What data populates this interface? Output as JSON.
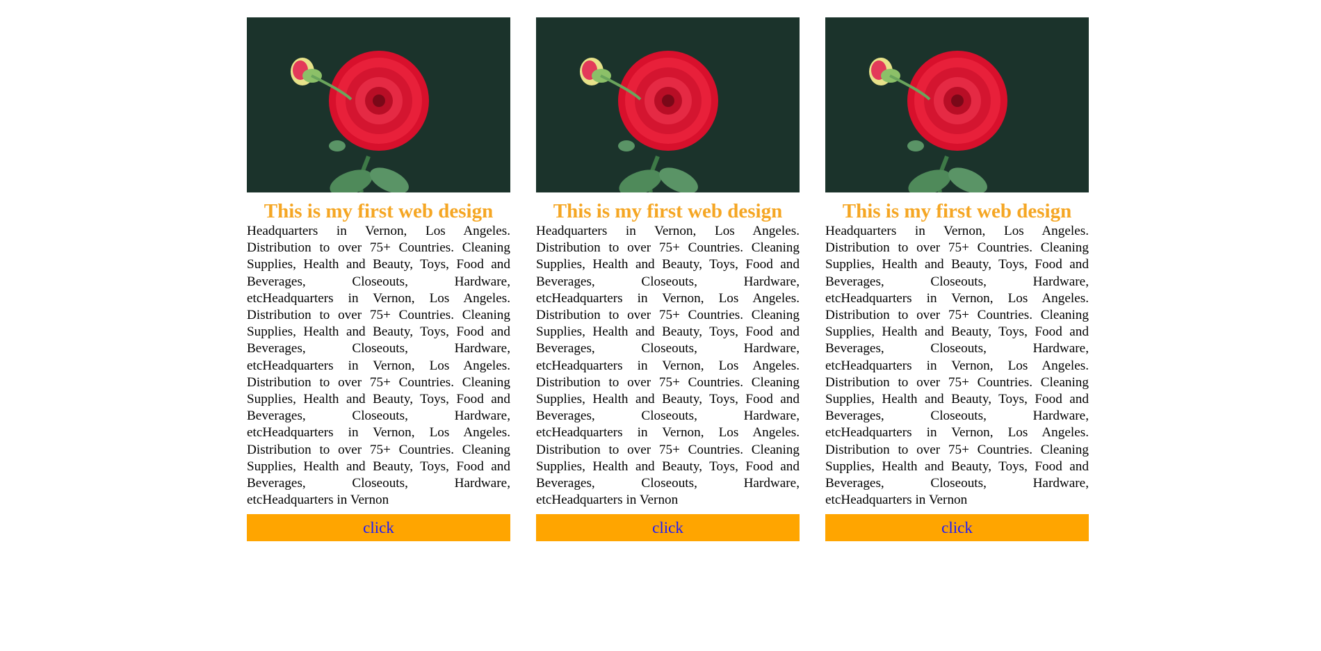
{
  "cards": [
    {
      "image_alt": "flower-image",
      "title": "This is my first web design",
      "text": "Headquarters in Vernon, Los Angeles. Distribution to over 75+ Countries. Cleaning Supplies, Health and Beauty, Toys, Food and Beverages, Closeouts, Hardware, etcHeadquarters in Vernon, Los Angeles. Distribution to over 75+ Countries. Cleaning Supplies, Health and Beauty, Toys, Food and Beverages, Closeouts, Hardware, etcHeadquarters in Vernon, Los Angeles. Distribution to over 75+ Countries. Cleaning Supplies, Health and Beauty, Toys, Food and Beverages, Closeouts, Hardware, etcHeadquarters in Vernon, Los Angeles. Distribution to over 75+ Countries. Cleaning Supplies, Health and Beauty, Toys, Food and Beverages, Closeouts, Hardware, etcHeadquarters in Vernon",
      "button_label": "click"
    },
    {
      "image_alt": "flower-image",
      "title": "This is my first web design",
      "text": "Headquarters in Vernon, Los Angeles. Distribution to over 75+ Countries. Cleaning Supplies, Health and Beauty, Toys, Food and Beverages, Closeouts, Hardware, etcHeadquarters in Vernon, Los Angeles. Distribution to over 75+ Countries. Cleaning Supplies, Health and Beauty, Toys, Food and Beverages, Closeouts, Hardware, etcHeadquarters in Vernon, Los Angeles. Distribution to over 75+ Countries. Cleaning Supplies, Health and Beauty, Toys, Food and Beverages, Closeouts, Hardware, etcHeadquarters in Vernon, Los Angeles. Distribution to over 75+ Countries. Cleaning Supplies, Health and Beauty, Toys, Food and Beverages, Closeouts, Hardware, etcHeadquarters in Vernon",
      "button_label": "click"
    },
    {
      "image_alt": "flower-image",
      "title": "This is my first web design",
      "text": "Headquarters in Vernon, Los Angeles. Distribution to over 75+ Countries. Cleaning Supplies, Health and Beauty, Toys, Food and Beverages, Closeouts, Hardware, etcHeadquarters in Vernon, Los Angeles. Distribution to over 75+ Countries. Cleaning Supplies, Health and Beauty, Toys, Food and Beverages, Closeouts, Hardware, etcHeadquarters in Vernon, Los Angeles. Distribution to over 75+ Countries. Cleaning Supplies, Health and Beauty, Toys, Food and Beverages, Closeouts, Hardware, etcHeadquarters in Vernon, Los Angeles. Distribution to over 75+ Countries. Cleaning Supplies, Health and Beauty, Toys, Food and Beverages, Closeouts, Hardware, etcHeadquarters in Vernon",
      "button_label": "click"
    }
  ],
  "colors": {
    "title": "#f5a623",
    "button_bg": "#ffa500",
    "button_text": "#1a1aff",
    "image_bg": "#1b332b"
  }
}
